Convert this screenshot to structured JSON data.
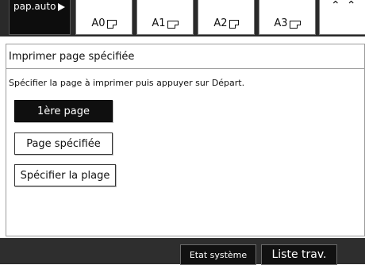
{
  "top_bar": {
    "paper_auto": {
      "label": "pap.auto",
      "icon": "play-triangle-icon"
    },
    "paper_sizes": [
      {
        "label": "A0",
        "icon": "portrait-page-icon"
      },
      {
        "label": "A1",
        "icon": "landscape-page-icon"
      },
      {
        "label": "A2",
        "icon": "portrait-page-icon"
      },
      {
        "label": "A3",
        "icon": "landscape-page-icon"
      }
    ]
  },
  "panel": {
    "title": "Imprimer page spécifiée",
    "instruction": "Spécifier la page à imprimer puis appuyer sur Départ.",
    "options": [
      {
        "label": "1ère page",
        "selected": true
      },
      {
        "label": "Page spécifiée",
        "selected": false
      },
      {
        "label": "Spécifier la plage",
        "selected": false
      }
    ]
  },
  "bottom_bar": {
    "system_status": "Etat système",
    "job_list": "Liste trav."
  },
  "colors": {
    "bar_background": "#2e2e2e",
    "selected_button": "#0f0f0f",
    "panel_border": "#9c9c9c"
  }
}
